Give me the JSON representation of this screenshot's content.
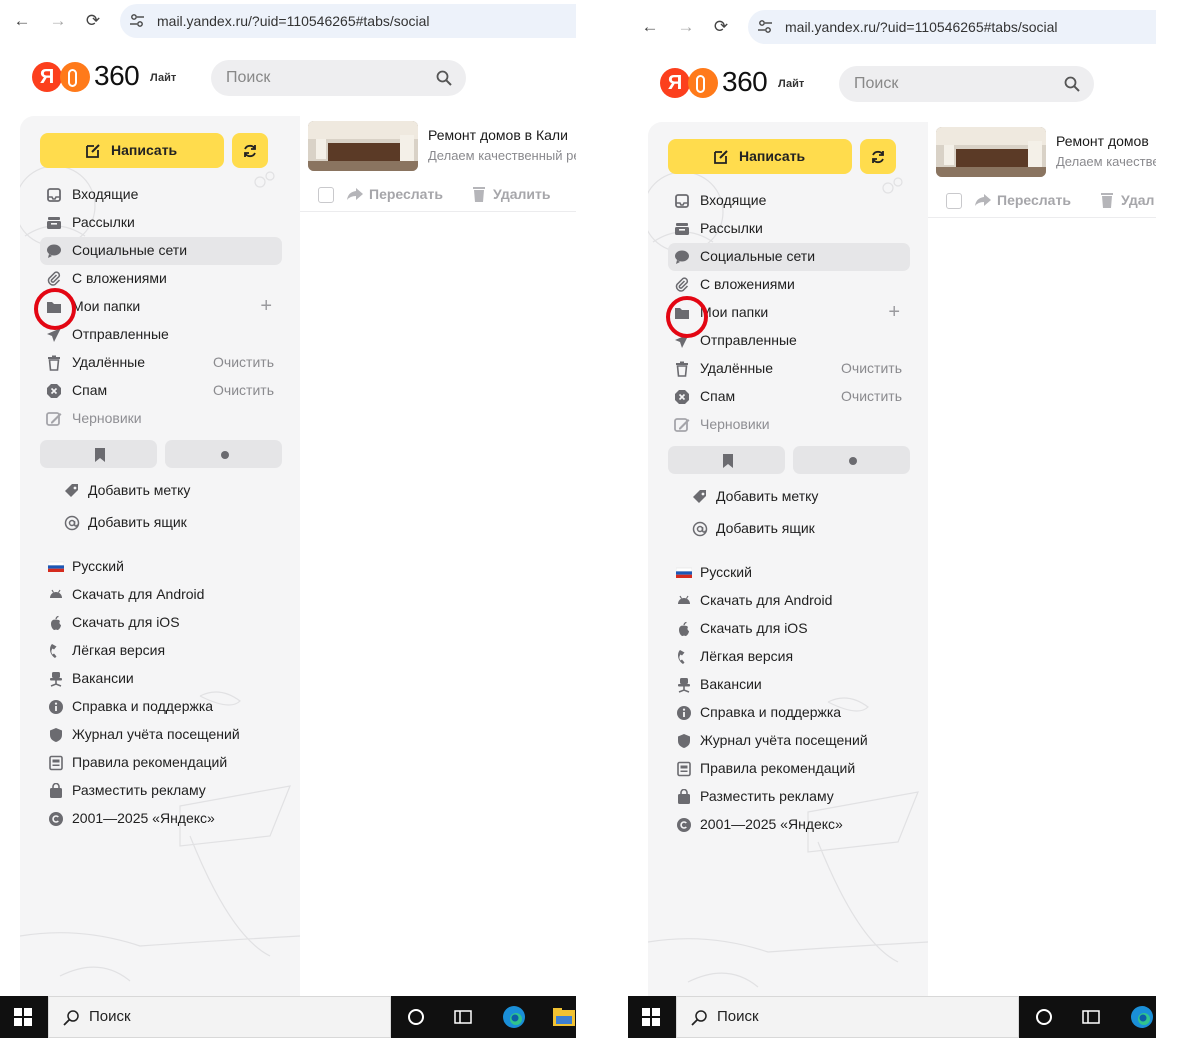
{
  "browser": {
    "url": "mail.yandex.ru/?uid=110546265#tabs/social",
    "back_icon": "arrow-left-icon",
    "forward_icon": "arrow-right-icon",
    "reload_icon": "reload-icon"
  },
  "header": {
    "logo_ya": "Я",
    "logo_360": "360",
    "logo_lite": "Лайт",
    "search_placeholder": "Поиск"
  },
  "sidebar": {
    "compose_label": "Написать",
    "folders": [
      {
        "label": "Входящие",
        "icon": "inbox-icon"
      },
      {
        "label": "Рассылки",
        "icon": "newsletter-icon"
      },
      {
        "label": "Социальные сети",
        "icon": "chat-bubble-icon",
        "selected": true
      },
      {
        "label": "С вложениями",
        "icon": "paperclip-icon"
      },
      {
        "label": "Мои папки",
        "icon": "folder-icon",
        "action": "+"
      },
      {
        "label": "Отправленные",
        "icon": "send-icon"
      },
      {
        "label": "Удалённые",
        "icon": "trash-icon",
        "action": "Очистить"
      },
      {
        "label": "Спам",
        "icon": "spam-icon",
        "action": "Очистить"
      },
      {
        "label": "Черновики",
        "icon": "draft-icon"
      }
    ],
    "extra": [
      {
        "label": "Добавить метку",
        "icon": "tag-icon"
      },
      {
        "label": "Добавить ящик",
        "icon": "at-icon"
      }
    ],
    "footer": [
      {
        "label": "Русский",
        "icon": "ru-flag-icon"
      },
      {
        "label": "Скачать для Android",
        "icon": "android-icon"
      },
      {
        "label": "Скачать для iOS",
        "icon": "apple-icon"
      },
      {
        "label": "Лёгкая версия",
        "icon": "phone-icon"
      },
      {
        "label": "Вакансии",
        "icon": "chair-icon"
      },
      {
        "label": "Справка и поддержка",
        "icon": "info-icon"
      },
      {
        "label": "Журнал учёта посещений",
        "icon": "shield-icon"
      },
      {
        "label": "Правила рекомендаций",
        "icon": "document-icon"
      },
      {
        "label": "Разместить рекламу",
        "icon": "bag-icon"
      },
      {
        "label": "2001—2025 «Яндекс»",
        "icon": "copyright-icon"
      }
    ]
  },
  "main": {
    "ad_title": "Ремонт домов в Кали",
    "ad_text": "Делаем качественный ре",
    "forward_label": "Переслать",
    "delete_label": "Удалить"
  },
  "right_panel": {
    "ad_title": "Ремонт домов",
    "ad_text": "Делаем качестве",
    "delete_label": "Удал"
  },
  "taskbar": {
    "search_label": "Поиск"
  },
  "colors": {
    "compose_yellow": "#ffdc4d",
    "annotation_red": "#e30613",
    "logo_red": "#fc3f1d",
    "logo_orange": "#ff7a1a"
  }
}
